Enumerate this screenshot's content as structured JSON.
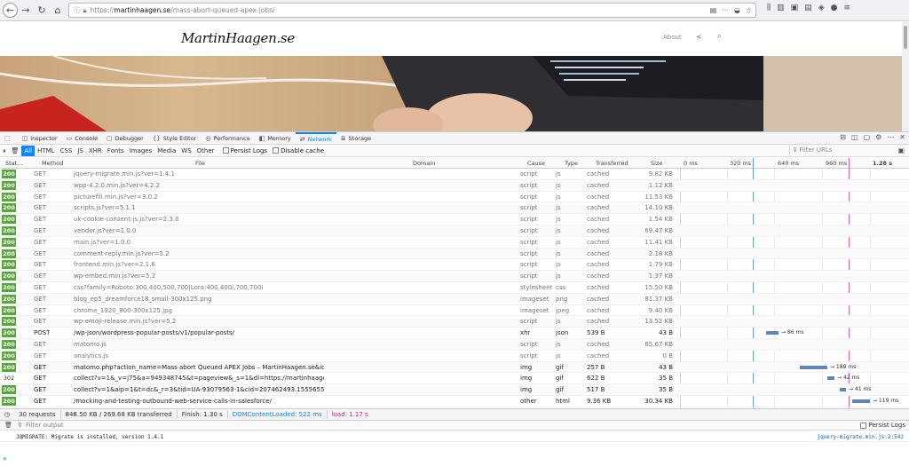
{
  "browser": {
    "url_proto": "https://",
    "url_host": "martinhaagen.se",
    "url_path": "/mass-abort-queued-apex-jobs/"
  },
  "site": {
    "logo": "MartinHaagen.se",
    "nav_about": "About"
  },
  "devtools": {
    "tabs": [
      {
        "label": "Inspector"
      },
      {
        "label": "Console"
      },
      {
        "label": "Debugger"
      },
      {
        "label": "Style Editor"
      },
      {
        "label": "Performance"
      },
      {
        "label": "Memory"
      },
      {
        "label": "Network"
      },
      {
        "label": "Storage"
      }
    ],
    "filters": [
      "All",
      "HTML",
      "CSS",
      "JS",
      "XHR",
      "Fonts",
      "Images",
      "Media",
      "WS",
      "Other"
    ],
    "persist_logs": "Persist Logs",
    "disable_cache": "Disable cache",
    "filter_placeholder": "Filter URLs",
    "columns": {
      "status": "Stat…",
      "method": "Method",
      "file": "File",
      "domain": "Domain",
      "cause": "Cause",
      "type": "Type",
      "transferred": "Transferred",
      "size": "Size"
    },
    "timeline": [
      "0 ms",
      "320 ms",
      "640 ms",
      "960 ms",
      "1.28 s"
    ],
    "requests": [
      {
        "status": "200",
        "method": "GET",
        "file": "jquery-migrate.min.js?ver=1.4.1",
        "domain": "martinhaagen.se",
        "cause": "script",
        "type": "js",
        "transferred": "cached",
        "size": "9.82 KB"
      },
      {
        "status": "200",
        "method": "GET",
        "file": "wpp-4.2.0.min.js?ver=4.2.2",
        "domain": "martinhaagen.se",
        "cause": "script",
        "type": "js",
        "transferred": "cached",
        "size": "1.12 KB"
      },
      {
        "status": "200",
        "method": "GET",
        "file": "picturefill.min.js?ver=3.0.2",
        "domain": "martinhaagen.se",
        "cause": "script",
        "type": "js",
        "transferred": "cached",
        "size": "11.53 KB"
      },
      {
        "status": "200",
        "method": "GET",
        "file": "scripts.js?ver=5.1.1",
        "domain": "martinhaagen.se",
        "cause": "script",
        "type": "js",
        "transferred": "cached",
        "size": "14.10 KB"
      },
      {
        "status": "200",
        "method": "GET",
        "file": "uk-cookie-consent-js.js?ver=2.3.0",
        "domain": "martinhaagen.se",
        "cause": "script",
        "type": "js",
        "transferred": "cached",
        "size": "1.54 KB"
      },
      {
        "status": "200",
        "method": "GET",
        "file": "vendor.js?ver=1.0.0",
        "domain": "martinhaagen.se",
        "cause": "script",
        "type": "js",
        "transferred": "cached",
        "size": "69.47 KB"
      },
      {
        "status": "200",
        "method": "GET",
        "file": "main.js?ver=1.0.0",
        "domain": "martinhaagen.se",
        "cause": "script",
        "type": "js",
        "transferred": "cached",
        "size": "11.41 KB"
      },
      {
        "status": "200",
        "method": "GET",
        "file": "comment-reply.min.js?ver=5.2",
        "domain": "martinhaagen.se",
        "cause": "script",
        "type": "js",
        "transferred": "cached",
        "size": "2.18 KB"
      },
      {
        "status": "200",
        "method": "GET",
        "file": "frontend.min.js?ver=2.1.6",
        "domain": "martinhaagen.se",
        "cause": "script",
        "type": "js",
        "transferred": "cached",
        "size": "1.79 KB"
      },
      {
        "status": "200",
        "method": "GET",
        "file": "wp-embed.min.js?ver=5.2",
        "domain": "martinhaagen.se",
        "cause": "script",
        "type": "js",
        "transferred": "cached",
        "size": "1.37 KB"
      },
      {
        "status": "200",
        "method": "GET",
        "file": "css?family=Roboto:300,400,500,700|Lora:400,400i,700,700i",
        "domain": "fonts.googleapis.com",
        "cause": "stylesheet",
        "type": "css",
        "transferred": "cached",
        "size": "15.50 KB"
      },
      {
        "status": "200",
        "method": "GET",
        "file": "blog_ep5_dreamforce18_small-300x125.png",
        "domain": "martinhaagen.se",
        "cause": "imageset",
        "type": "png",
        "transferred": "cached",
        "size": "81.37 KB"
      },
      {
        "status": "200",
        "method": "GET",
        "file": "chrome_1920_800-300x125.jpg",
        "domain": "martinhaagen.se",
        "cause": "imageset",
        "type": "jpeg",
        "transferred": "cached",
        "size": "9.40 KB"
      },
      {
        "status": "200",
        "method": "GET",
        "file": "wp-emoji-release.min.js?ver=5.2",
        "domain": "martinhaagen.se",
        "cause": "script",
        "type": "js",
        "transferred": "cached",
        "size": "13.52 KB"
      },
      {
        "status": "200",
        "method": "POST",
        "file": "/wp-json/wordpress-popular-posts/v1/popular-posts/",
        "domain": "martinhaagen.se",
        "cause": "xhr",
        "type": "json",
        "transferred": "539 B",
        "size": "43 B",
        "timing": "→ 86 ms",
        "dark": true
      },
      {
        "status": "200",
        "method": "GET",
        "file": "matomo.js",
        "domain": "matomo.mbh.se",
        "cause": "script",
        "type": "js",
        "transferred": "cached",
        "size": "65.67 KB"
      },
      {
        "status": "200",
        "method": "GET",
        "file": "analytics.js",
        "domain": "www.google-analytics.com",
        "cause": "script",
        "type": "js",
        "transferred": "cached",
        "size": "0 B"
      },
      {
        "status": "200",
        "method": "GET",
        "file": "matomo.php?action_name=Mass abort Queued APEX Jobs – MartinHaagen.se&id…",
        "domain": "matomo.mbh.se",
        "cause": "img",
        "type": "gif",
        "transferred": "257 B",
        "size": "43 B",
        "timing": "→ 189 ms",
        "dark": true
      },
      {
        "status": "302",
        "method": "GET",
        "file": "collect?v=1&_v=j75&a=949348745&t=pageview&_s=1&dl=https://martinhaage…",
        "domain": "www.google-analytics.com",
        "cause": "img",
        "type": "gif",
        "transferred": "622 B",
        "size": "35 B",
        "timing": "→ 42 ms",
        "dark": true
      },
      {
        "status": "200",
        "method": "GET",
        "file": "collect?v=1&aip=1&t=dc&_r=3&tid=UA-93079563-1&cid=207462493.15556557…",
        "domain": "stats.g.doubleclick.net",
        "cause": "img",
        "type": "gif",
        "transferred": "517 B",
        "size": "35 B",
        "timing": "→ 41 ms",
        "dark": true
      },
      {
        "status": "200",
        "method": "GET",
        "file": "/mocking-and-testing-outbound-web-service-calls-in-salesforce/",
        "domain": "martinhaagen.se",
        "cause": "other",
        "type": "html",
        "transferred": "9.36 KB",
        "size": "30.34 KB",
        "timing": "→ 119 ms",
        "dark": true
      }
    ],
    "summary": {
      "requests": "30 requests",
      "transferred": "848.50 KB / 269.68 KB transferred",
      "finish": "Finish: 1.30 s",
      "domcontent": "DOMContentLoaded: 522 ms",
      "load": "load: 1.17 s"
    },
    "console": {
      "filter_placeholder": "Filter output",
      "persist": "Persist Logs",
      "message": "JQMIGRATE: Migrate is installed, version 1.4.1",
      "source": "jquery-migrate.min.js:2:542"
    }
  }
}
